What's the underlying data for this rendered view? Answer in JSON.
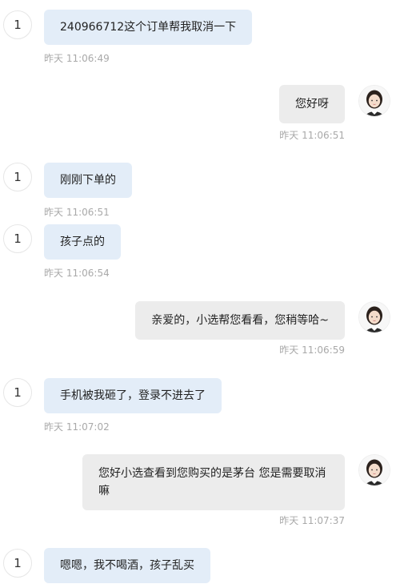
{
  "messages": [
    {
      "side": "user",
      "avatar": "1",
      "text": "240966712这个订单帮我取消一下",
      "time": "昨天 11:06:49"
    },
    {
      "side": "agent",
      "text": "您好呀",
      "time": "昨天 11:06:51"
    },
    {
      "side": "user",
      "avatar": "1",
      "text": "刚刚下单的",
      "time": "昨天 11:06:51"
    },
    {
      "side": "user",
      "avatar": "1",
      "text": "孩子点的",
      "time": "昨天 11:06:54"
    },
    {
      "side": "agent",
      "text": "亲爱的，小选帮您看看，您稍等哈~",
      "time": "昨天 11:06:59"
    },
    {
      "side": "user",
      "avatar": "1",
      "text": "手机被我砸了，登录不进去了",
      "time": "昨天 11:07:02"
    },
    {
      "side": "agent",
      "text": "您好小选查看到您购买的是茅台 您是需要取消嘛",
      "time": "昨天 11:07:37"
    },
    {
      "side": "user",
      "avatar": "1",
      "text": "嗯嗯，我不喝酒，孩子乱买",
      "time": ""
    }
  ]
}
